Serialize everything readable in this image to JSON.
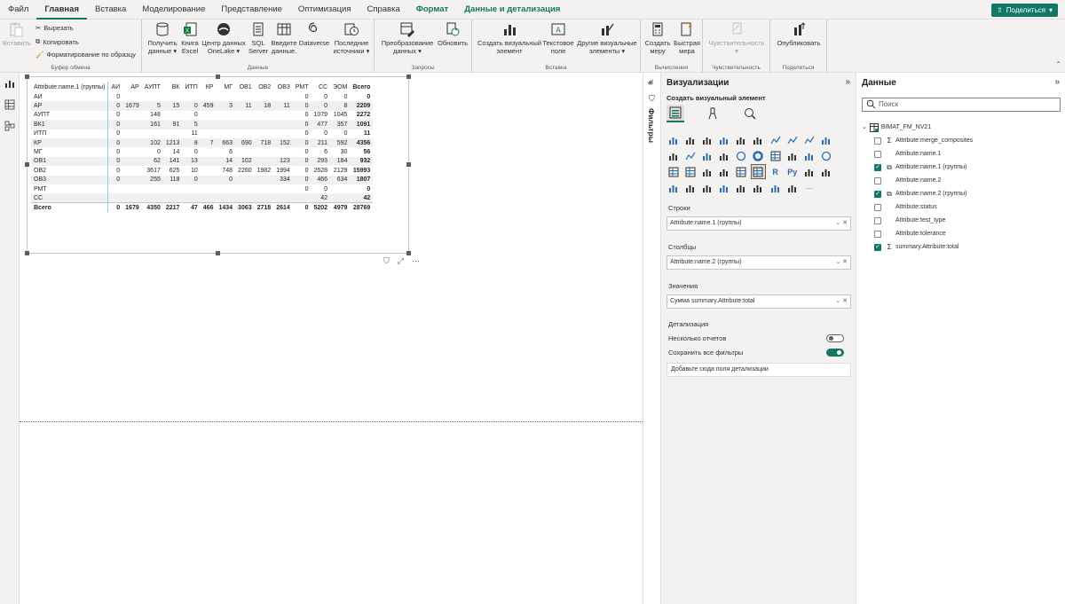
{
  "menu": {
    "tabs": [
      "Файл",
      "Главная",
      "Вставка",
      "Моделирование",
      "Представление",
      "Оптимизация",
      "Справка",
      "Формат",
      "Данные и детализация"
    ],
    "share": "Поделиться"
  },
  "ribbon": {
    "clipboard": {
      "paste": "Вставить",
      "cut": "Вырезать",
      "copy": "Копировать",
      "format_painter": "Форматирование по образцу",
      "group": "Буфер обмена"
    },
    "data": {
      "get_data": "Получить данные",
      "excel": "Книга Excel",
      "onelake": "Центр данных OneLake",
      "sql": "SQL Server",
      "enter_data": "Введите данные.",
      "dataverse": "Dataverse",
      "recent": "Последние источники",
      "group": "Данные"
    },
    "queries": {
      "transform": "Преобразование данных",
      "refresh": "Обновить",
      "group": "Запросы"
    },
    "insert": {
      "new_visual": "Создать визуальный элемент",
      "text_box": "Текстовое поле",
      "more_visuals": "Другие визуальные элементы",
      "group": "Вставка"
    },
    "calc": {
      "new_measure": "Создать меру",
      "quick_measure": "Быстрая мера",
      "group": "Вычисления"
    },
    "sensitivity": {
      "label": "Чувствительность",
      "group": "Чувствительность"
    },
    "share": {
      "publish": "Опубликовать",
      "group": "Поделиться"
    }
  },
  "matrix": {
    "row_header": "Attribute:name.1 (группы)",
    "columns": [
      "АИ",
      "АР",
      "АУПТ",
      "ВК",
      "ИТП",
      "КР",
      "МГ",
      "ОВ1",
      "ОВ2",
      "ОВ3",
      "РМТ",
      "СС",
      "ЭОМ",
      "Всего"
    ],
    "rows": [
      {
        "label": "АИ",
        "cells": [
          "0",
          "",
          "",
          "",
          "",
          "",
          "",
          "",
          "",
          "",
          "0",
          "0",
          "0",
          "0"
        ]
      },
      {
        "label": "АР",
        "cells": [
          "0",
          "1679",
          "5",
          "15",
          "0",
          "459",
          "3",
          "11",
          "18",
          "11",
          "0",
          "0",
          "8",
          "2209"
        ]
      },
      {
        "label": "АУПТ",
        "cells": [
          "0",
          "",
          "148",
          "",
          "0",
          "",
          "",
          "",
          "",
          "",
          "0",
          "1079",
          "1045",
          "2272"
        ]
      },
      {
        "label": "ВК1",
        "cells": [
          "0",
          "",
          "161",
          "91",
          "5",
          "",
          "",
          "",
          "",
          "",
          "0",
          "477",
          "357",
          "1091"
        ]
      },
      {
        "label": "ИТП",
        "cells": [
          "0",
          "",
          "",
          "",
          "11",
          "",
          "",
          "",
          "",
          "",
          "0",
          "0",
          "0",
          "11"
        ]
      },
      {
        "label": "КР",
        "cells": [
          "0",
          "",
          "102",
          "1213",
          "8",
          "7",
          "663",
          "690",
          "718",
          "152",
          "0",
          "211",
          "592",
          "4356"
        ]
      },
      {
        "label": "МГ",
        "cells": [
          "0",
          "",
          "0",
          "14",
          "0",
          "",
          "6",
          "",
          "",
          "",
          "0",
          "6",
          "30",
          "56"
        ]
      },
      {
        "label": "ОВ1",
        "cells": [
          "0",
          "",
          "62",
          "141",
          "13",
          "",
          "14",
          "102",
          "",
          "123",
          "0",
          "293",
          "184",
          "932"
        ]
      },
      {
        "label": "ОВ2",
        "cells": [
          "0",
          "",
          "3617",
          "625",
          "10",
          "",
          "748",
          "2260",
          "1982",
          "1994",
          "0",
          "2628",
          "2129",
          "15993"
        ]
      },
      {
        "label": "ОВ3",
        "cells": [
          "0",
          "",
          "255",
          "118",
          "0",
          "",
          "0",
          "",
          "",
          "334",
          "0",
          "466",
          "634",
          "1807"
        ]
      },
      {
        "label": "РМТ",
        "cells": [
          "",
          "",
          "",
          "",
          "",
          "",
          "",
          "",
          "",
          "",
          "0",
          "0",
          "",
          "0"
        ]
      },
      {
        "label": "СС",
        "cells": [
          "",
          "",
          "",
          "",
          "",
          "",
          "",
          "",
          "",
          "",
          "",
          "42",
          "",
          "42"
        ]
      }
    ],
    "total": {
      "label": "Всего",
      "cells": [
        "0",
        "1679",
        "4350",
        "2217",
        "47",
        "466",
        "1434",
        "3063",
        "2718",
        "2614",
        "0",
        "5202",
        "4979",
        "28769"
      ]
    }
  },
  "filters": {
    "label": "Фильтры"
  },
  "viz": {
    "title": "Визуализации",
    "build_label": "Создать визуальный элемент",
    "rows_label": "Строки",
    "rows_field": "Attribute:name.1 (группы)",
    "cols_label": "Столбцы",
    "cols_field": "Attribute:name.2 (группы)",
    "values_label": "Значения",
    "values_field": "Сумма summary.Attribute:total",
    "drill_label": "Детализация",
    "cross_report": "Несколько отчетов",
    "cross_report_on": false,
    "keep_filters": "Сохранить все фильтры",
    "keep_filters_on": true,
    "drill_add": "Добавьте сюда поля детализации"
  },
  "data_pane": {
    "title": "Данные",
    "search_placeholder": "Поиск",
    "table": "BIMAT_FM_NV21",
    "fields": [
      {
        "name": "Attribute:merge_composites",
        "checked": false,
        "icon": "sigma"
      },
      {
        "name": "Attribute:name.1",
        "checked": false,
        "icon": ""
      },
      {
        "name": "Attribute:name.1 (группы)",
        "checked": true,
        "icon": "group"
      },
      {
        "name": "Attribute:name.2",
        "checked": false,
        "icon": ""
      },
      {
        "name": "Attribute:name.2 (группы)",
        "checked": true,
        "icon": "group"
      },
      {
        "name": "Attribute:status",
        "checked": false,
        "icon": ""
      },
      {
        "name": "Attribute:test_type",
        "checked": false,
        "icon": ""
      },
      {
        "name": "Attribute:tolerance",
        "checked": false,
        "icon": ""
      },
      {
        "name": "summary.Attribute:total",
        "checked": true,
        "icon": "sigma"
      }
    ]
  },
  "colors": {
    "accent": "#117865",
    "ribbon_bg": "#f3f2f1",
    "band": "#f0f0f0"
  }
}
